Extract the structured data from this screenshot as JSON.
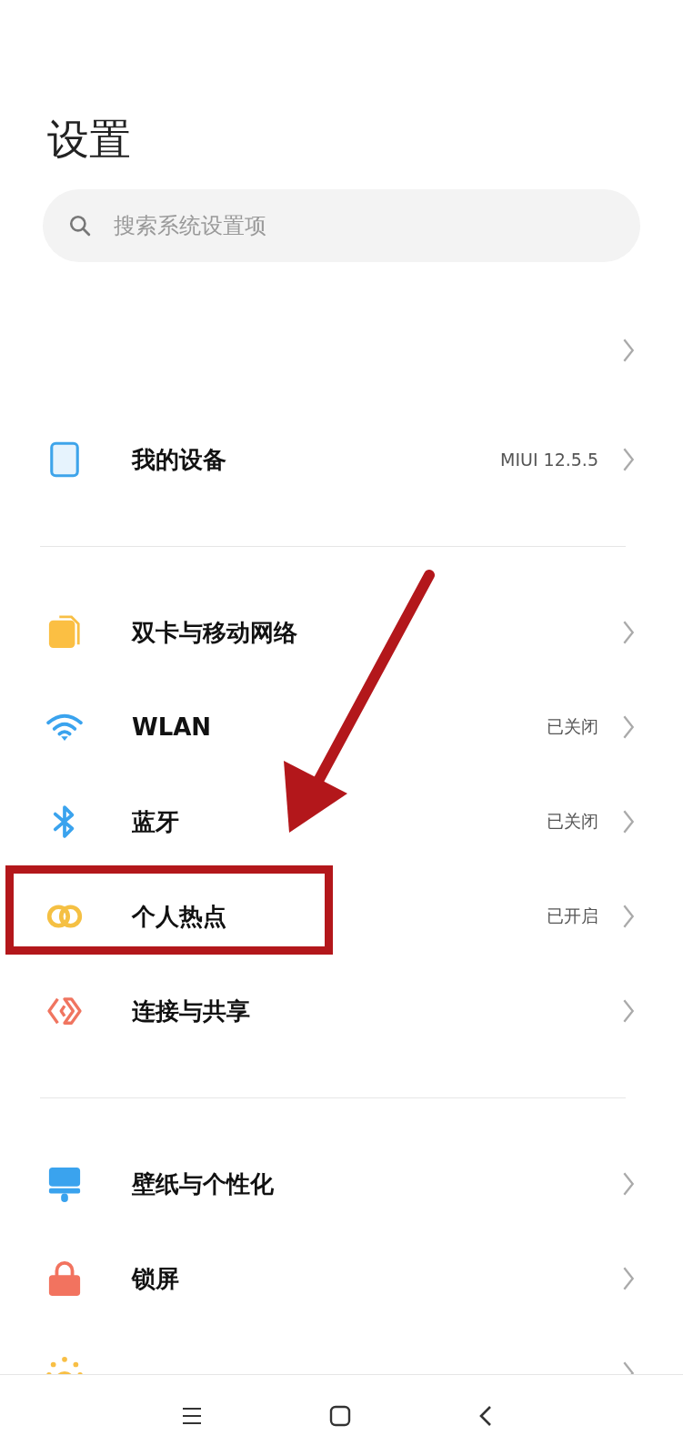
{
  "title": "设置",
  "search": {
    "placeholder": "搜索系统设置项"
  },
  "sections": [
    {
      "items": [
        {
          "kind": "chevron_only"
        },
        {
          "kind": "item",
          "label": "我的设备",
          "value": "MIUI 12.5.5",
          "highlighted": false
        }
      ]
    },
    {
      "items": [
        {
          "kind": "item",
          "label": "双卡与移动网络",
          "highlighted": false
        },
        {
          "kind": "item",
          "label": "WLAN",
          "value": "已关闭",
          "highlighted": false
        },
        {
          "kind": "item",
          "label": "蓝牙",
          "value": "已关闭",
          "highlighted": false
        },
        {
          "kind": "item",
          "label": "个人热点",
          "value": "已开启",
          "highlighted": true
        },
        {
          "kind": "item",
          "label": "连接与共享",
          "highlighted": false
        }
      ]
    },
    {
      "items": [
        {
          "kind": "item",
          "label": "壁纸与个性化",
          "highlighted": false
        },
        {
          "kind": "item",
          "label": "锁屏",
          "highlighted": false
        },
        {
          "kind": "item",
          "highlighted": false
        }
      ]
    }
  ]
}
